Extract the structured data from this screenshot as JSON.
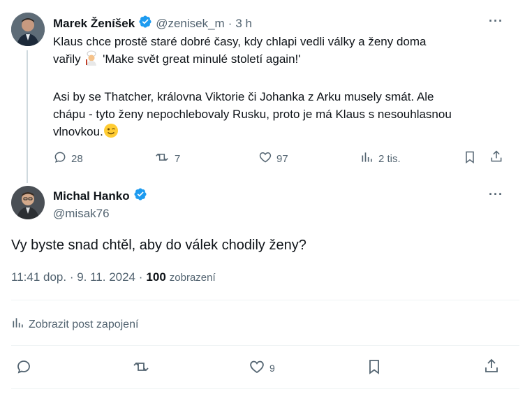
{
  "parent_tweet": {
    "author_name": "Marek Ženíšek",
    "handle": "@zenisek_m",
    "separator": "·",
    "time_ago": "3 h",
    "text_line1": "Klaus chce prostě staré dobré časy, kdy chlapi vedli války a ženy doma",
    "text_line2_prefix": "vařily",
    "text_line2_suffix": " 'Make svět great minulé století again!'",
    "text_para2_line1": "Asi by se Thatcher, královna Viktorie či Johanka z Arku musely smát. Ale",
    "text_para2_line2": "chápu - tyto ženy nepochlebovaly Rusku, proto je má Klaus s nesouhlasnou",
    "text_para2_line3": "vlnovkou.",
    "replies": "28",
    "reposts": "7",
    "likes": "97",
    "views": "2 tis.",
    "more_label": "···"
  },
  "main_tweet": {
    "author_name": "Michal Hanko",
    "handle": "@misak76",
    "text": "Vy byste snad chtěl, aby do válek chodily ženy?",
    "timestamp": "11:41 dop. · 9. 11. 2024 ·",
    "views_count": "100",
    "views_label": "zobrazení",
    "engagements_link": "Zobrazit post zapojení",
    "likes": "9",
    "more_label": "···"
  },
  "colors": {
    "verified": "#1d9bf0",
    "muted": "#536471",
    "divider": "#eff3f4"
  },
  "icons": [
    "reply-icon",
    "repost-icon",
    "like-icon",
    "views-icon",
    "bookmark-icon",
    "share-icon",
    "chef-emoji",
    "wink-emoji"
  ]
}
